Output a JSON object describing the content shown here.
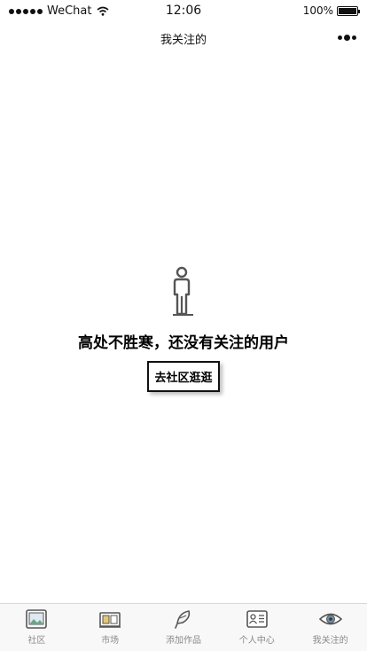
{
  "status_bar": {
    "carrier": "WeChat",
    "time": "12:06",
    "battery": "100%"
  },
  "nav": {
    "title": "我关注的",
    "more_icon": "more-dots-icon"
  },
  "empty_state": {
    "icon": "person-icon",
    "message": "高处不胜寒，还没有关注的用户",
    "button_label": "去社区逛逛"
  },
  "tabs": [
    {
      "label": "社区",
      "icon": "community-picture-icon"
    },
    {
      "label": "市场",
      "icon": "market-shop-icon"
    },
    {
      "label": "添加作品",
      "icon": "add-work-feather-icon"
    },
    {
      "label": "个人中心",
      "icon": "profile-card-icon"
    },
    {
      "label": "我关注的",
      "icon": "eye-icon"
    }
  ],
  "colors": {
    "tab_bar_bg": "#f8f8f8",
    "tab_label": "#8a8a8a",
    "icon_stroke": "#555555"
  }
}
